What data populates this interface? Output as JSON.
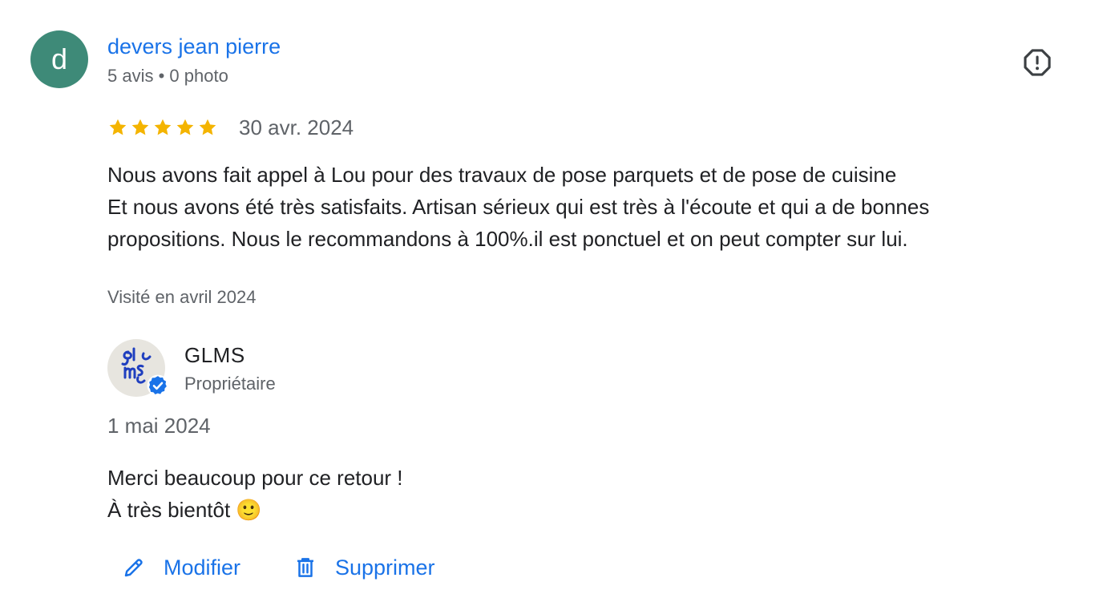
{
  "reviewer": {
    "initial": "d",
    "name": "devers jean pierre",
    "meta": "5 avis • 0 photo"
  },
  "review": {
    "rating": 5,
    "date": "30 avr. 2024",
    "lines": [
      "Nous avons fait appel à Lou pour des travaux de pose parquets et de pose de cuisine",
      "Et nous avons été très satisfaits. Artisan sérieux qui est très à l'écoute et qui a de bonnes",
      "propositions. Nous le recommandons à 100%.il est ponctuel et on peut compter sur lui."
    ],
    "visit": "Visité en avril 2024"
  },
  "owner_reply": {
    "name": "GLMS",
    "role": "Propriétaire",
    "logo_text": "glms",
    "date": "1 mai 2024",
    "lines": [
      "Merci beaucoup pour ce retour !",
      "À très bientôt 🙂"
    ]
  },
  "actions": {
    "edit_label": "Modifier",
    "delete_label": "Supprimer"
  },
  "colors": {
    "accent": "#1a73e8",
    "avatar": "#3e8a78",
    "star": "#f4b400",
    "muted_text": "#5f6368"
  },
  "icons": {
    "report": "report-icon",
    "star": "star-icon",
    "verified": "verified-badge-icon",
    "edit": "pencil-icon",
    "delete": "trash-icon"
  }
}
